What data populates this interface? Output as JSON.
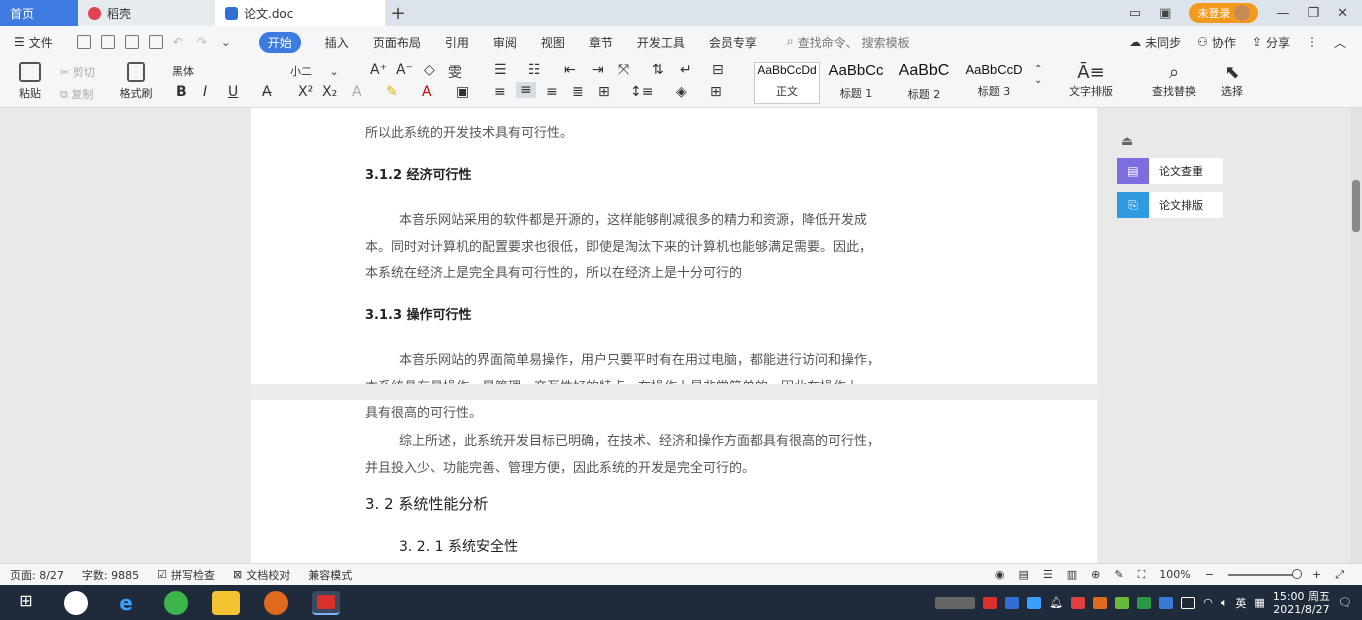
{
  "tabs": {
    "home": "首页",
    "draft": "稻壳",
    "doc": "论文.doc",
    "plus": "+",
    "login": "未登录"
  },
  "menu": {
    "file": "文件",
    "start": "开始",
    "insert": "插入",
    "layout": "页面布局",
    "references": "引用",
    "review": "审阅",
    "view": "视图",
    "chapter": "章节",
    "devtools": "开发工具",
    "member": "会员专享",
    "search_cmd": "查找命令、",
    "search_tpl": "搜索模板",
    "unsynced": "未同步",
    "collab": "协作",
    "share": "分享"
  },
  "ribbon": {
    "paste": "粘贴",
    "cut": "剪切",
    "copy": "复制",
    "format_brush": "格式刷",
    "font_name": "黑体",
    "font_size": "小二",
    "bold": "B",
    "italic": "I",
    "underline": "U",
    "styles": [
      {
        "sample": "AaBbCcDd",
        "label": "正文"
      },
      {
        "sample": "AaBbCc",
        "label": "标题 1"
      },
      {
        "sample": "AaBbC",
        "label": "标题 2"
      },
      {
        "sample": "AaBbCcD",
        "label": "标题 3"
      }
    ],
    "text_layout": "文字排版",
    "find_replace": "查找替换",
    "select": "选择"
  },
  "document": {
    "l0": "所以此系统的开发技术具有可行性。",
    "h_312": "3.1.2 经济可行性",
    "p1_1": "本音乐网站采用的软件都是开源的，这样能够削减很多的精力和资源，降低开发成",
    "p1_2": "本。同时对计算机的配置要求也很低，即使是淘汰下来的计算机也能够满足需要。因此，",
    "p1_3": "本系统在经济上是完全具有可行性的，所以在经济上是十分可行的",
    "h_313": "3.1.3 操作可行性",
    "p2_1": "本音乐网站的界面简单易操作，用户只要平时有在用过电脑，都能进行访问和操作，",
    "p2_2": "本系统具有易操作、易管理、交互性好的特点，在操作上是非常简单的。因此在操作上",
    "p2_3": "具有很高的可行性。",
    "p3_1": "综上所述，此系统开发目标已明确，在技术、经济和操作方面都具有很高的可行性，",
    "p3_2": "并且投入少、功能完善、管理方便，因此系统的开发是完全可行的。",
    "h_32": "3. 2 系统性能分析",
    "h_321": "3. 2. 1  系统安全性"
  },
  "side_panel": {
    "check": "论文查重",
    "format": "论文排版"
  },
  "status": {
    "page": "页面: 8/27",
    "words": "字数: 9885",
    "spell": "拼写检查",
    "proof": "文档校对",
    "compat": "兼容模式",
    "zoom": "100%"
  },
  "taskbar": {
    "input_lang": "英",
    "time": "15:00 周五",
    "date": "2021/8/27"
  },
  "colors": {
    "accent": "#3d7be0",
    "login": "#f39a1e",
    "taskbar": "#1f2b3a"
  }
}
